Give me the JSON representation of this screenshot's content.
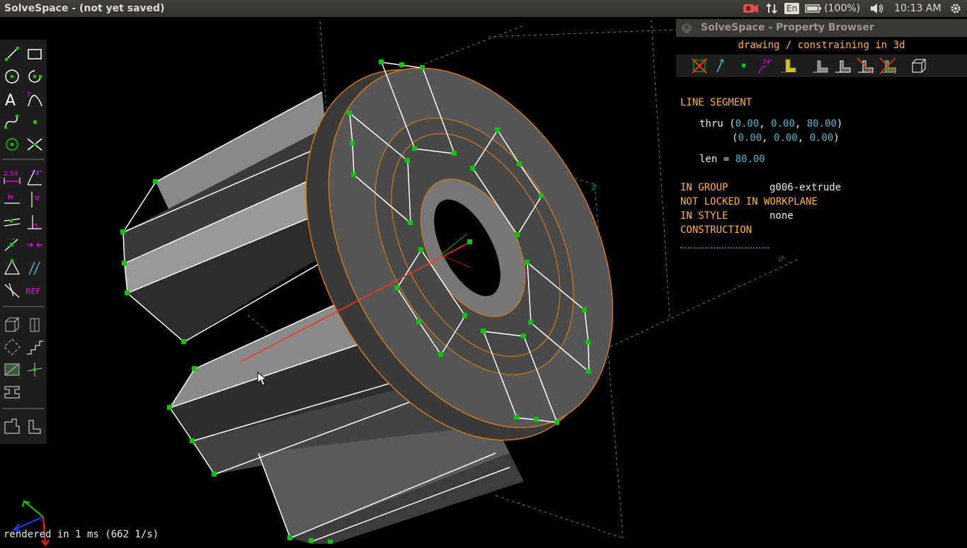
{
  "window": {
    "title": "SolveSpace - (not yet saved)"
  },
  "tray": {
    "keyboard": "En",
    "battery": "(100%)",
    "clock": "10:13 AM"
  },
  "toolbar": {
    "icons": [
      "line-icon",
      "rectangle-icon",
      "circle-icon",
      "arc-icon",
      "text-icon",
      "tangent-arc-icon",
      "bezier-icon",
      "point-icon",
      "workplane-icon",
      "split-icon",
      "distance-icon",
      "angle-icon",
      "horizontal-icon",
      "vertical-icon",
      "parallel-icon",
      "perpendicular-icon",
      "point-on-icon",
      "symmetric-icon",
      "equal-icon",
      "same-orientation-icon",
      "other-angle-icon",
      "reference-icon",
      "sketch-3d-icon",
      "sketch-workplane-icon",
      "step-rotate-icon",
      "step-translate-icon",
      "extrude-icon",
      "revolve-icon",
      "lathe-icon",
      "assemble-icon",
      "link-icon"
    ],
    "distance_label": "2.54",
    "angle_label": "74°",
    "horizontal_label": "H",
    "vertical_label": "V",
    "ref_label": "REF"
  },
  "property_browser": {
    "title": "SolveSpace - Property Browser",
    "mode": "drawing / constraining in 3d",
    "entity_type": "LINE SEGMENT",
    "thru_label": "thru",
    "p1": [
      "0.00",
      "0.00",
      "80.00"
    ],
    "p2": [
      "0.00",
      "0.00",
      "0.00"
    ],
    "len_label": "len =",
    "len_value": "80.00",
    "in_group_label": "IN GROUP",
    "in_group_value": "g006-extrude",
    "locked_label": "NOT LOCKED IN WORKPLANE",
    "style_label": "IN STYLE",
    "style_value": "none",
    "construction_label": "CONSTRUCTION",
    "angle_icon_label": "74°"
  },
  "status": {
    "render_text": "rendered in 1 ms (662 1/s)"
  },
  "colors": {
    "accent_orange": "#ffb33a",
    "value_cyan": "#53b5c8",
    "point_green": "#10c010",
    "magenta": "#ff00ff",
    "selection_red": "#ff3020"
  }
}
